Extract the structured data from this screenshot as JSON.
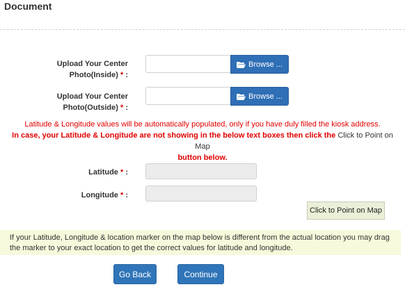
{
  "section": {
    "title": "Document"
  },
  "upload_inside": {
    "label_line1": "Upload Your Center",
    "label_line2": "Photo(Inside)",
    "required_mark": "*",
    "colon": ":",
    "browse_label": "Browse ..."
  },
  "upload_outside": {
    "label_line1": "Upload Your Center",
    "label_line2": "Photo(Outside)",
    "required_mark": "*",
    "colon": ":",
    "browse_label": "Browse ..."
  },
  "notice": {
    "line1": "Latitude & Longitude values will be automatically populated, only if you have duly filled the kiosk address.",
    "line2_bold": "In case, your Latitude & Longitude are not showing in the below text boxes then click the",
    "line2_plain": "Click to Point on Map",
    "line3_bold": "button below."
  },
  "latitude": {
    "label": "Latitude",
    "required_mark": "*",
    "colon": ":",
    "value": ""
  },
  "longitude": {
    "label": "Longitude",
    "required_mark": "*",
    "colon": ":",
    "value": ""
  },
  "map_button": {
    "label": "Click to Point on Map"
  },
  "info": {
    "text": "If your Latitude, Longitude & location marker on the map below is different from the actual location you may drag the marker to your exact location to get the correct values for latitude and longitude."
  },
  "actions": {
    "back_label": "Go Back",
    "continue_label": "Continue"
  },
  "colors": {
    "primary_button": "#3075b9",
    "required": "#e00000",
    "info_bg": "#f8f8dc",
    "map_button_bg": "#eaf0d8"
  }
}
